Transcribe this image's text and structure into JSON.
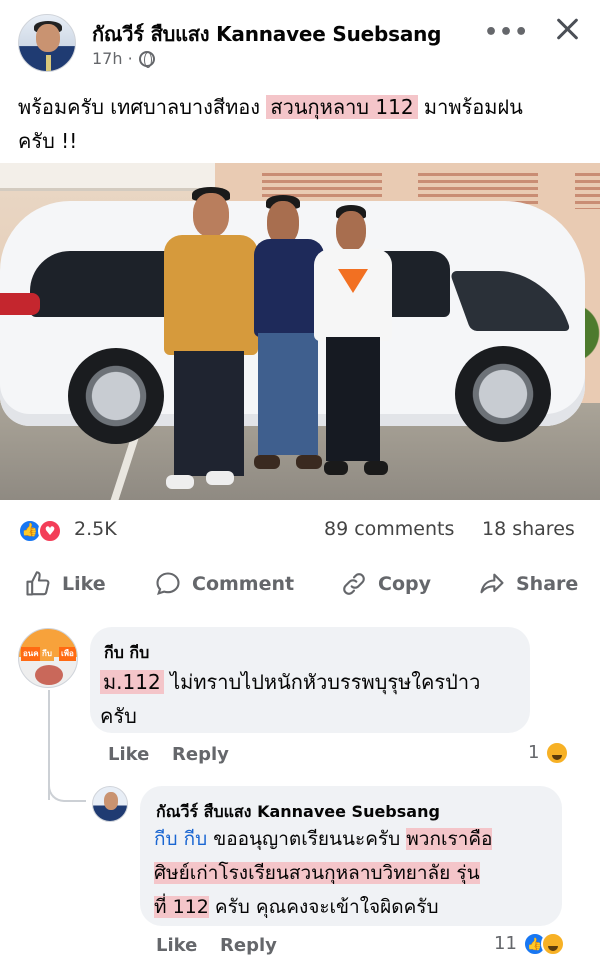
{
  "post": {
    "author": "กัณวีร์ สืบแสง Kannavee Suebsang",
    "time": "17h ·",
    "more_label": "•••",
    "caption_line1_a": "พร้อมครับ เทศบาลบางสีทอง ",
    "caption_highlight": "สวนกุหลาบ 112",
    "caption_line1_b": " มาพร้อมฝน",
    "caption_line2": "ครับ !!"
  },
  "stats": {
    "reactions": "2.5K",
    "comments": "89 comments",
    "shares": "18 shares"
  },
  "actions": {
    "like": "Like",
    "comment": "Comment",
    "copy": "Copy",
    "share": "Share"
  },
  "comment1": {
    "author": "กีบ กีบ",
    "text_highlight": "ม.112",
    "text_rest": " ไม่ทราบไปหนักหัวบรรพบุรุษใครป่าว",
    "text_line2": "ครับ",
    "like": "Like",
    "reply": "Reply",
    "reaction_count": "1",
    "avatar_tags": [
      "อนค",
      "กีบ",
      "เพือ"
    ]
  },
  "comment2": {
    "author": "กัณวีร์ สืบแสง Kannavee Suebsang",
    "mention": "กีบ กีบ",
    "text_a": " ขออนุญาตเรียนนะครับ ",
    "text_hl1": "พวกเราคือ",
    "text_hl2": "ศิษย์เก่าโรงเรียนสวนกุหลาบวิทยาลัย รุ่น",
    "text_hl3": "ที่ 112",
    "text_b": " ครับ คุณคงจะเข้าใจผิดครับ",
    "like": "Like",
    "reply": "Reply",
    "reaction_count": "11"
  },
  "colors": {
    "highlight": "#f4c5c9",
    "mention": "#1a66d2",
    "like_blue": "#1877f2",
    "love_red": "#f33e58",
    "secondary_text": "#65676b"
  }
}
